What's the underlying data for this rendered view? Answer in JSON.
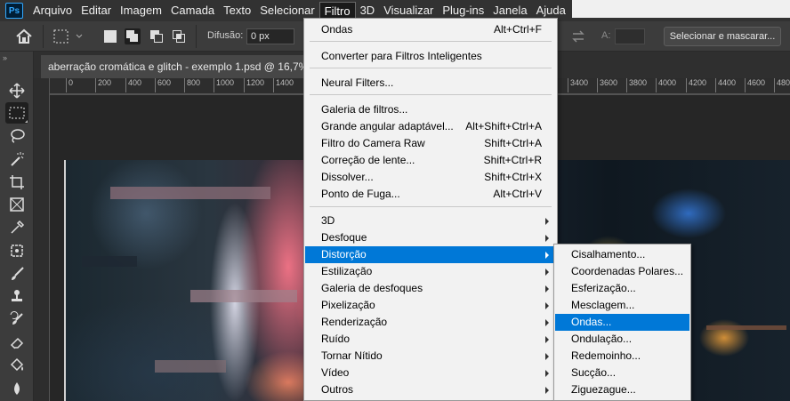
{
  "app": {
    "logo_text": "Ps"
  },
  "menubar": {
    "items": [
      "Arquivo",
      "Editar",
      "Imagem",
      "Camada",
      "Texto",
      "Selecionar",
      "Filtro",
      "3D",
      "Visualizar",
      "Plug-ins",
      "Janela",
      "Ajuda"
    ],
    "active": "Filtro"
  },
  "options_bar": {
    "difusao_label": "Difusão:",
    "difusao_value": "0 px",
    "a_label": "A:",
    "select_mask_label": "Selecionar e mascarar..."
  },
  "document": {
    "tab_title": "aberração cromática e glitch - exemplo 1.psd @ 16,7% (",
    "ruler_ticks": [
      "0",
      "200",
      "400",
      "600",
      "800",
      "1000",
      "1200",
      "1400",
      "3400",
      "3600",
      "3800",
      "4000",
      "4200",
      "4400",
      "4600",
      "4800"
    ]
  },
  "filter_menu": {
    "items": [
      {
        "label": "Ondas",
        "shortcut": "Alt+Ctrl+F"
      },
      {
        "label": "Converter para Filtros Inteligentes"
      },
      {
        "label": "Neural Filters..."
      },
      {
        "label": "Galeria de filtros..."
      },
      {
        "label": "Grande angular adaptável...",
        "shortcut": "Alt+Shift+Ctrl+A"
      },
      {
        "label": "Filtro do Camera Raw",
        "shortcut": "Shift+Ctrl+A"
      },
      {
        "label": "Correção de lente...",
        "shortcut": "Shift+Ctrl+R"
      },
      {
        "label": "Dissolver...",
        "shortcut": "Shift+Ctrl+X"
      },
      {
        "label": "Ponto de Fuga...",
        "shortcut": "Alt+Ctrl+V"
      },
      {
        "label": "3D"
      },
      {
        "label": "Desfoque"
      },
      {
        "label": "Distorção"
      },
      {
        "label": "Estilização"
      },
      {
        "label": "Galeria de desfoques"
      },
      {
        "label": "Pixelização"
      },
      {
        "label": "Renderização"
      },
      {
        "label": "Ruído"
      },
      {
        "label": "Tornar Nítido"
      },
      {
        "label": "Vídeo"
      },
      {
        "label": "Outros"
      }
    ],
    "highlighted": "Distorção"
  },
  "distortion_submenu": {
    "items": [
      "Cisalhamento...",
      "Coordenadas Polares...",
      "Esferização...",
      "Mesclagem...",
      "Ondas...",
      "Ondulação...",
      "Redemoinho...",
      "Sucção...",
      "Ziguezague..."
    ],
    "highlighted": "Ondas..."
  },
  "colors": {
    "highlight": "#0078d7",
    "menu_bg": "#f2f2f2",
    "app_bg": "#323232"
  }
}
